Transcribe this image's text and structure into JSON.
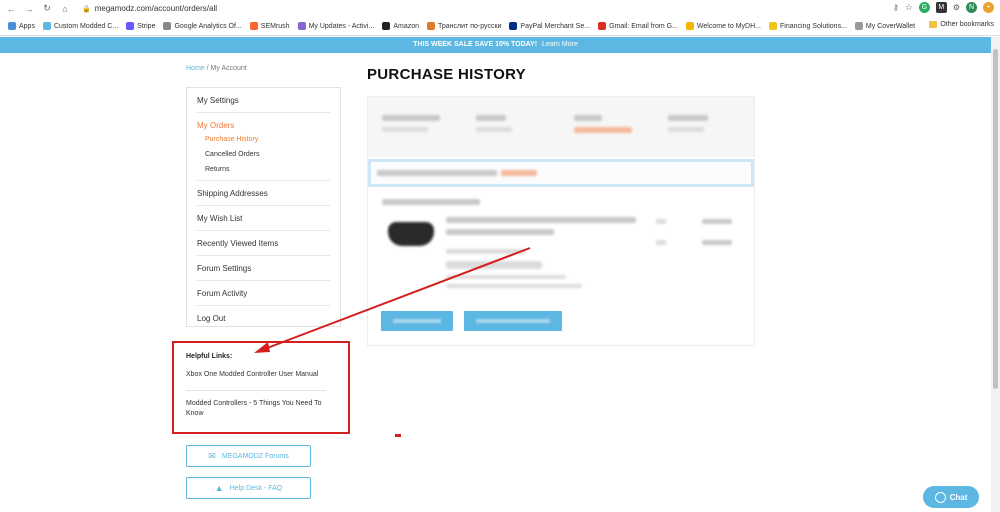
{
  "browser": {
    "url": "megamodz.com/account/orders/all",
    "bookmarks": [
      {
        "label": "Apps",
        "color": "#4a90d9"
      },
      {
        "label": "Custom Modded C...",
        "color": "#5cb7e2"
      },
      {
        "label": "Stripe",
        "color": "#635bff"
      },
      {
        "label": "Google Analytics Of...",
        "color": "#888"
      },
      {
        "label": "SEMrush",
        "color": "#ff642d"
      },
      {
        "label": "My Updates - Activi...",
        "color": "#8a63d2"
      },
      {
        "label": "Amazon",
        "color": "#222"
      },
      {
        "label": "Транслит по-русски",
        "color": "#e07b26"
      },
      {
        "label": "PayPal Merchant Se...",
        "color": "#003087"
      },
      {
        "label": "Gmail: Email from G...",
        "color": "#d93025"
      },
      {
        "label": "Welcome to MyDH...",
        "color": "#f4b400"
      },
      {
        "label": "Financing Solutions...",
        "color": "#f0c419"
      },
      {
        "label": "My CoverWallet",
        "color": "#999"
      }
    ],
    "other_bookmarks": "Other bookmarks"
  },
  "promo": {
    "text": "THIS WEEK SALE SAVE 10% TODAY!",
    "link": "Learn More"
  },
  "breadcrumb": {
    "home": "Home",
    "separator": "/",
    "current": "My Account"
  },
  "sidebar": {
    "my_settings": "My Settings",
    "my_orders": "My Orders",
    "purchase_history": "Purchase History",
    "cancelled_orders": "Cancelled Orders",
    "returns": "Returns",
    "shipping_addresses": "Shipping Addresses",
    "wish_list": "My Wish List",
    "recently_viewed": "Recently Viewed Items",
    "forum_settings": "Forum Settings",
    "forum_activity": "Forum Activity",
    "log_out": "Log Out"
  },
  "helpful": {
    "heading": "Helpful Links:",
    "link1": "Xbox One Modded Controller User Manual",
    "link2": "Modded Controllers - 5 Things You Need To Know"
  },
  "buttons": {
    "forums": "MEGAMODZ Forums",
    "helpdesk": "Help Desk - FAQ"
  },
  "main": {
    "title": "PURCHASE HISTORY"
  },
  "chat": {
    "label": "Chat"
  }
}
